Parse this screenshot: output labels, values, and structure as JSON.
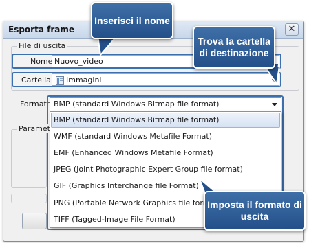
{
  "window": {
    "title": "Esporta frame",
    "close_glyph": "✕"
  },
  "output_group": {
    "legend": "File di uscita",
    "name_label": "Nome",
    "name_value": "Nuovo_video",
    "folder_label": "Cartella",
    "folder_value": "Immagini",
    "folder_icon": "folder-icon"
  },
  "format": {
    "label": "Formato",
    "selected": "BMP (standard Windows Bitmap file format)",
    "options": [
      "BMP (standard Windows Bitmap file format)",
      "WMF (standard Windows Metafile Format)",
      "EMF (Enhanced Windows Metafile Format)",
      "JPEG (Joint Photographic Expert Group file format)",
      "GIF (Graphics Interchange file Format)",
      "PNG (Portable Network Graphics file format)",
      "TIFF (Tagged-Image File Format)"
    ]
  },
  "params_group": {
    "legend": "Parametri"
  },
  "callouts": {
    "name": "Inserisci il nome",
    "folder_line1": "Trova la cartella",
    "folder_line2": "di destinazione",
    "format_line1": "Imposta il formato di",
    "format_line2": "uscita"
  },
  "colors": {
    "callout_bg": "#2f5f9a",
    "highlight_border": "#3c6fae",
    "selection_bg": "#dfe8f6"
  }
}
